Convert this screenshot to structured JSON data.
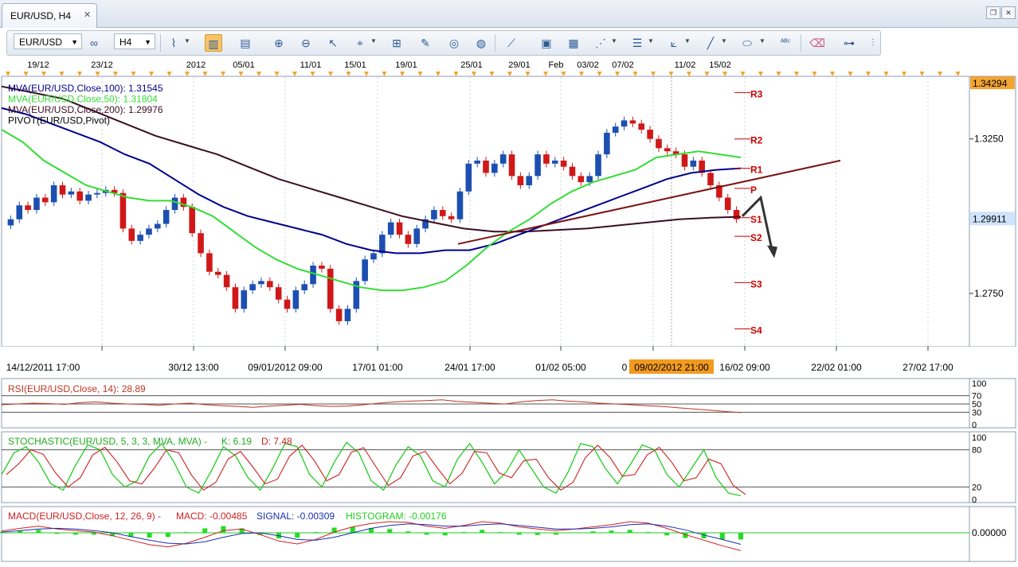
{
  "window": {
    "tab_title": "EUR/USD, H4",
    "close_glyph": "✕",
    "restore_glyph": "❐",
    "close_window_glyph": "✕"
  },
  "toolbar": {
    "symbol": "EUR/USD",
    "timeframe": "H4",
    "tools": [
      "pattern-icon",
      "chart-type-icon",
      "bar-chart-icon",
      "candle-chart-icon",
      "zoom-in-icon",
      "zoom-out-icon",
      "cursor-icon",
      "crosshair-icon",
      "indicator-icon",
      "edit-icon",
      "hide-icon",
      "globe-icon",
      "ruler-icon",
      "image-icon",
      "template-icon",
      "trendline-icon",
      "hline-icon",
      "fib-icon",
      "draw-line-icon",
      "ellipse-icon",
      "text-icon",
      "eraser-icon",
      "objects-icon"
    ]
  },
  "chart_data": {
    "type": "candlestick",
    "symbol": "EUR/USD",
    "timeframe": "H4",
    "top_date_labels": [
      "19/12",
      "23/12",
      "2012",
      "05/01",
      "11/01",
      "15/01",
      "19/01",
      "25/01",
      "29/01",
      "Feb",
      "03/02",
      "07/02",
      "11/02",
      "15/02"
    ],
    "bottom_date_labels": [
      "14/12/2011 17:00",
      "30/12 13:00",
      "09/01/2012 09:00",
      "17/01 01:00",
      "24/01 17:00",
      "01/02 05:00",
      "0",
      "16/02 09:00",
      "22/02 01:00",
      "27/02 17:00"
    ],
    "crosshair_time": "09/02/2012 21:00",
    "price_axis": {
      "ylim": [
        1.258,
        1.345
      ],
      "ticks": [
        "1.3250",
        "1.2750"
      ],
      "last_price": "1.29911",
      "top_price": "1.34294"
    },
    "legend": [
      {
        "text": "MVA(EUR/USD,Close,100): 1.31545",
        "color": "#00008b"
      },
      {
        "text": "MVA(EUR/USD,Close,50): 1.31804",
        "color": "#33dd33"
      },
      {
        "text": "MVA(EUR/USD,Close,200): 1.29976",
        "color": "#3a0e22"
      },
      {
        "text": "PIVOT(EUR/USD,Pivot)",
        "color": "#000000"
      }
    ],
    "pivots": [
      {
        "label": "R3",
        "value": 1.34
      },
      {
        "label": "R2",
        "value": 1.325
      },
      {
        "label": "R1",
        "value": 1.3155
      },
      {
        "label": "P",
        "value": 1.309
      },
      {
        "label": "S1",
        "value": 1.2995
      },
      {
        "label": "S2",
        "value": 1.2935
      },
      {
        "label": "S3",
        "value": 1.2785
      },
      {
        "label": "S4",
        "value": 1.2635
      }
    ],
    "close_path": [
      1.299,
      1.3035,
      1.302,
      1.306,
      1.3045,
      1.31,
      1.307,
      1.308,
      1.305,
      1.307,
      1.3075,
      1.3085,
      1.3075,
      1.296,
      1.292,
      1.294,
      1.296,
      1.2975,
      1.302,
      1.306,
      1.303,
      1.2945,
      1.288,
      1.282,
      1.281,
      1.277,
      1.27,
      1.276,
      1.278,
      1.279,
      1.277,
      1.273,
      1.27,
      1.276,
      1.278,
      1.284,
      1.283,
      1.27,
      1.266,
      1.27,
      1.279,
      1.286,
      1.288,
      1.294,
      1.298,
      1.294,
      1.291,
      1.296,
      1.299,
      1.302,
      1.3,
      1.299,
      1.308,
      1.317,
      1.318,
      1.314,
      1.317,
      1.32,
      1.313,
      1.31,
      1.313,
      1.32,
      1.317,
      1.318,
      1.316,
      1.313,
      1.311,
      1.313,
      1.32,
      1.327,
      1.329,
      1.331,
      1.33,
      1.328,
      1.325,
      1.322,
      1.321,
      1.32,
      1.316,
      1.318,
      1.314,
      1.31,
      1.306,
      1.302,
      1.299
    ],
    "mva50": [
      1.328,
      1.324,
      1.318,
      1.314,
      1.31,
      1.308,
      1.306,
      1.305,
      1.305,
      1.303,
      1.3,
      1.295,
      1.29,
      1.286,
      1.283,
      1.281,
      1.279,
      1.277,
      1.276,
      1.276,
      1.277,
      1.279,
      1.284,
      1.29,
      1.295,
      1.299,
      1.304,
      1.308,
      1.311,
      1.313,
      1.315,
      1.319,
      1.32,
      1.321,
      1.32,
      1.319
    ],
    "mva100": [
      1.335,
      1.333,
      1.33,
      1.327,
      1.324,
      1.32,
      1.317,
      1.312,
      1.307,
      1.303,
      1.3,
      1.298,
      1.296,
      1.294,
      1.291,
      1.289,
      1.288,
      1.288,
      1.289,
      1.289,
      1.291,
      1.294,
      1.297,
      1.3,
      1.303,
      1.306,
      1.309,
      1.312,
      1.314,
      1.315,
      1.3155
    ],
    "mva200": [
      1.342,
      1.34,
      1.338,
      1.334,
      1.33,
      1.326,
      1.323,
      1.32,
      1.316,
      1.312,
      1.309,
      1.306,
      1.303,
      1.3,
      1.298,
      1.296,
      1.295,
      1.295,
      1.2955,
      1.296,
      1.297,
      1.298,
      1.299,
      1.2995,
      1.2998
    ],
    "trendline_label": "",
    "forecast_arrow": [
      [
        1.3,
        1.306,
        1.288
      ]
    ],
    "rsi": {
      "label": "RSI(EUR/USD,Close, 14): 28.89",
      "levels": [
        "100",
        "70",
        "50",
        "30",
        "0"
      ],
      "value": 28.89,
      "values": [
        48,
        50,
        52,
        51,
        49,
        53,
        55,
        52,
        50,
        49,
        47,
        50,
        52,
        48,
        46,
        44,
        42,
        45,
        47,
        49,
        46,
        44,
        45,
        48,
        52,
        55,
        57,
        58,
        60,
        56,
        54,
        52,
        50,
        55,
        58,
        60,
        57,
        55,
        52,
        50,
        48,
        46,
        44,
        41,
        38,
        35,
        32,
        29
      ]
    },
    "stochastic": {
      "label": "STOCHASTIC(EUR/USD, 5, 3, 3, MVA, MVA) -",
      "k": "K: 6.19",
      "d": "D: 7.48",
      "levels": [
        "100",
        "80",
        "20",
        "0"
      ],
      "k_values": [
        40,
        75,
        85,
        60,
        25,
        15,
        55,
        88,
        80,
        40,
        20,
        30,
        70,
        90,
        60,
        20,
        10,
        45,
        85,
        70,
        35,
        15,
        50,
        90,
        85,
        40,
        20,
        60,
        92,
        75,
        30,
        15,
        55,
        85,
        70,
        30,
        20,
        65,
        90,
        60,
        25,
        45,
        80,
        50,
        20,
        10,
        45,
        90,
        85,
        50,
        25,
        55,
        88,
        80,
        40,
        20,
        50,
        80,
        35,
        10,
        6
      ]
    },
    "macd": {
      "label": "MACD(EUR/USD,Close, 12, 26, 9) -",
      "macd_text": "MACD: -0.00485",
      "signal_text": "SIGNAL: -0.00309",
      "histogram_text": "HISTOGRAM: -0.00176",
      "zero_tick": "0.00000",
      "macd_values": [
        0.0005,
        0.0012,
        0.0018,
        0.001,
        0.0006,
        0.0002,
        -0.0008,
        -0.002,
        -0.0032,
        -0.0038,
        -0.0028,
        -0.0012,
        0.0006,
        0.001,
        -0.0005,
        -0.0022,
        -0.003,
        -0.0018,
        0.0002,
        0.0016,
        0.0025,
        0.003,
        0.0028,
        0.0018,
        0.0012,
        0.002,
        0.003,
        0.0026,
        0.0016,
        0.001,
        0.0006,
        0.001,
        0.0016,
        0.0022,
        0.003,
        0.0026,
        0.0012,
        -0.0005,
        -0.002,
        -0.0035,
        -0.0048
      ],
      "signal_values": [
        0.0002,
        0.0006,
        0.001,
        0.0012,
        0.001,
        0.0006,
        0.0,
        -0.001,
        -0.002,
        -0.0028,
        -0.003,
        -0.0024,
        -0.0012,
        -0.0002,
        0.0,
        -0.0008,
        -0.0018,
        -0.002,
        -0.0012,
        0.0,
        0.0012,
        0.002,
        0.0024,
        0.0022,
        0.0018,
        0.0018,
        0.0022,
        0.0024,
        0.002,
        0.0015,
        0.001,
        0.001,
        0.0012,
        0.0016,
        0.0022,
        0.0024,
        0.0018,
        0.0008,
        -0.0006,
        -0.0018,
        -0.0031
      ]
    }
  },
  "colors": {
    "up": "#1c4fb0",
    "down": "#d01818",
    "pivot_label": "#cc0000",
    "pivot_line": "#cc0000",
    "grid": "#c9d3e0",
    "highlight": "#f29a1f",
    "price_badge": "#cfe3fb",
    "ohlc_wick": "#333333"
  }
}
